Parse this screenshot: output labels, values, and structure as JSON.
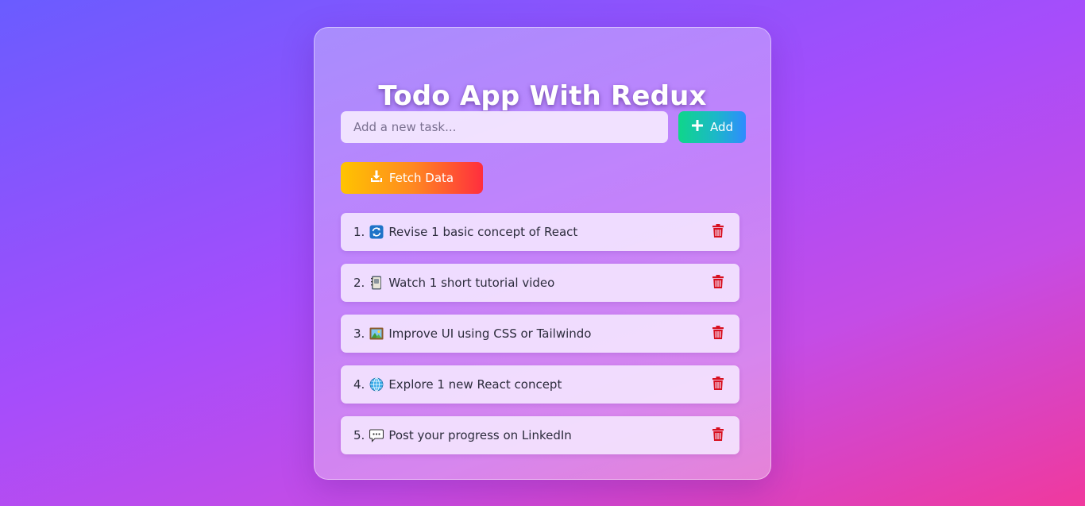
{
  "app": {
    "title": "Todo App With Redux"
  },
  "form": {
    "input_value": "",
    "input_placeholder": "Add a new task...",
    "add_label": "Add",
    "add_icon": "plus-icon",
    "fetch_label": "Fetch Data",
    "fetch_icon": "download-icon"
  },
  "todos": [
    {
      "number": "1.",
      "icon": "repeat-icon",
      "text": "Revise 1 basic concept of React"
    },
    {
      "number": "2.",
      "icon": "notebook-icon",
      "text": "Watch 1 short tutorial video"
    },
    {
      "number": "3.",
      "icon": "framed-picture-icon",
      "text": "Improve UI using CSS or Tailwindo"
    },
    {
      "number": "4.",
      "icon": "globe-icon",
      "text": "Explore 1 new React concept"
    },
    {
      "number": "5.",
      "icon": "speech-bubble-icon",
      "text": "Post your progress on LinkedIn"
    }
  ],
  "colors": {
    "delete_icon": "#d80f1f",
    "add_gradient": [
      "#0fd68a",
      "#2f8bff"
    ],
    "fetch_gradient": [
      "#ffc400",
      "#ff2e3e"
    ]
  }
}
